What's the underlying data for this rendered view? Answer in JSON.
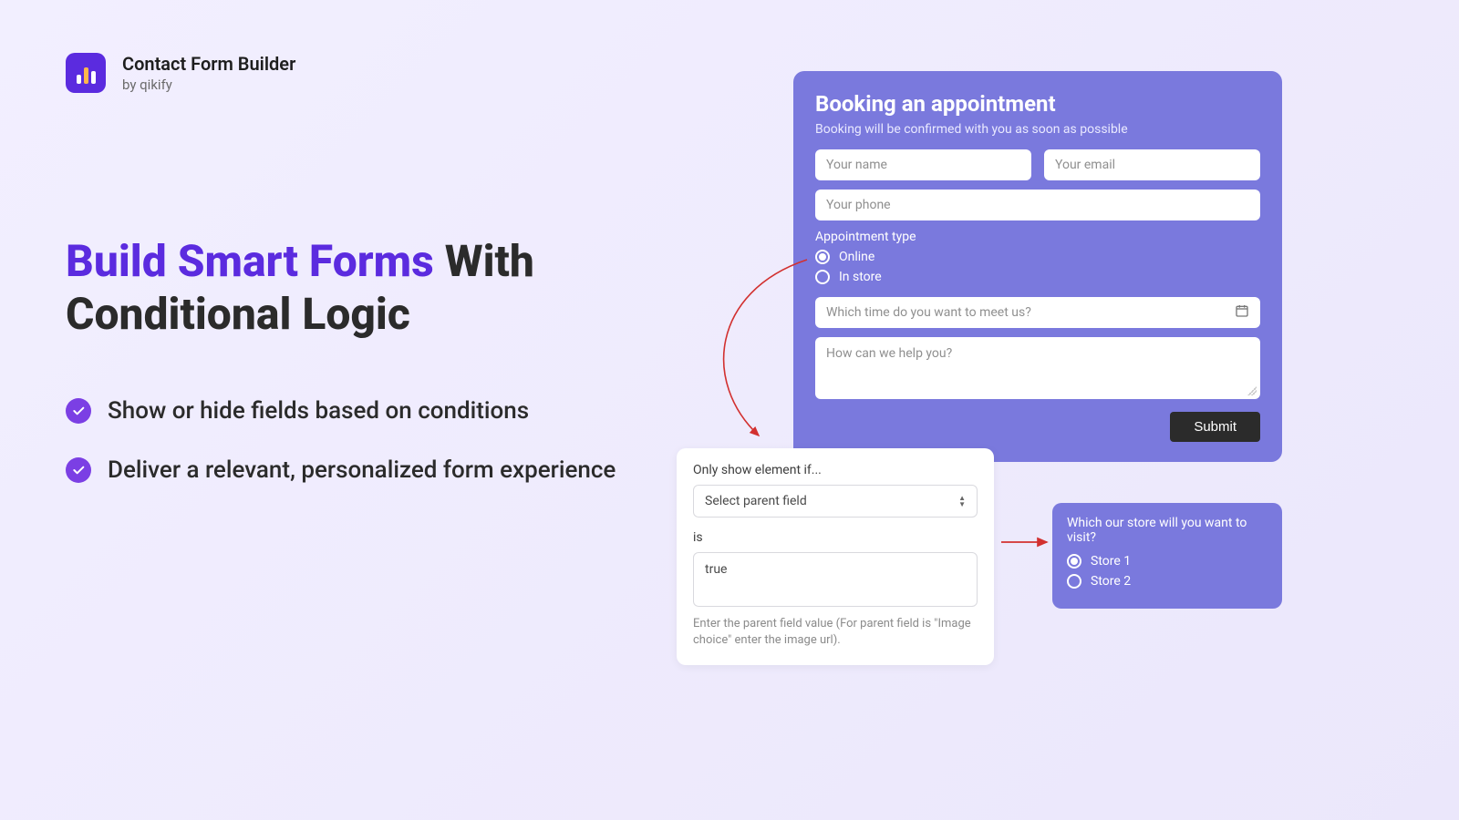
{
  "brand": {
    "title": "Contact Form Builder",
    "byline": "by qikify"
  },
  "headline": {
    "accent": "Build Smart Forms",
    "rest": " With Conditional Logic"
  },
  "bullets": [
    "Show or hide fields based on conditions",
    "Deliver a relevant, personalized form experience"
  ],
  "form": {
    "title": "Booking an appointment",
    "subtitle": "Booking will be confirmed with you as soon as possible",
    "name_placeholder": "Your name",
    "email_placeholder": "Your email",
    "phone_placeholder": "Your phone",
    "appt_type_label": "Appointment type",
    "appt_options": [
      "Online",
      "In store"
    ],
    "appt_selected_index": 0,
    "time_placeholder": "Which time do you want to meet us?",
    "message_placeholder": "How can we help you?",
    "submit_label": "Submit"
  },
  "condition": {
    "heading": "Only show element if...",
    "select_placeholder": "Select parent field",
    "is_label": "is",
    "value": "true",
    "hint": "Enter the parent field value (For parent field is \"Image choice\" enter the image url)."
  },
  "store": {
    "question": "Which our store will you want to visit?",
    "options": [
      "Store 1",
      "Store 2"
    ],
    "selected_index": 0
  }
}
